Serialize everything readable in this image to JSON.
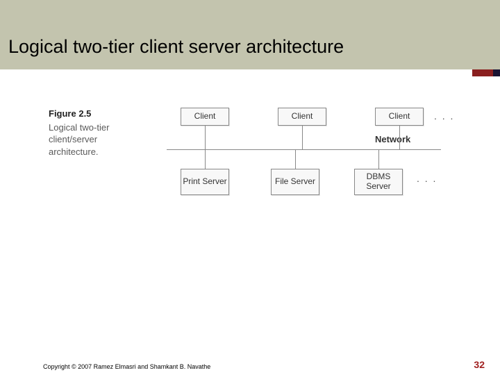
{
  "slide": {
    "title": "Logical two-tier client server architecture"
  },
  "figure": {
    "number": "Figure 2.5",
    "caption": "Logical two-tier client/server architecture.",
    "network_label": "Network",
    "clients": [
      "Client",
      "Client",
      "Client"
    ],
    "servers": [
      "Print Server",
      "File Server",
      "DBMS Server"
    ],
    "ellipsis": ". . ."
  },
  "footer": {
    "copyright": "Copyright © 2007 Ramez Elmasri and Shamkant B. Navathe",
    "page": "32"
  }
}
